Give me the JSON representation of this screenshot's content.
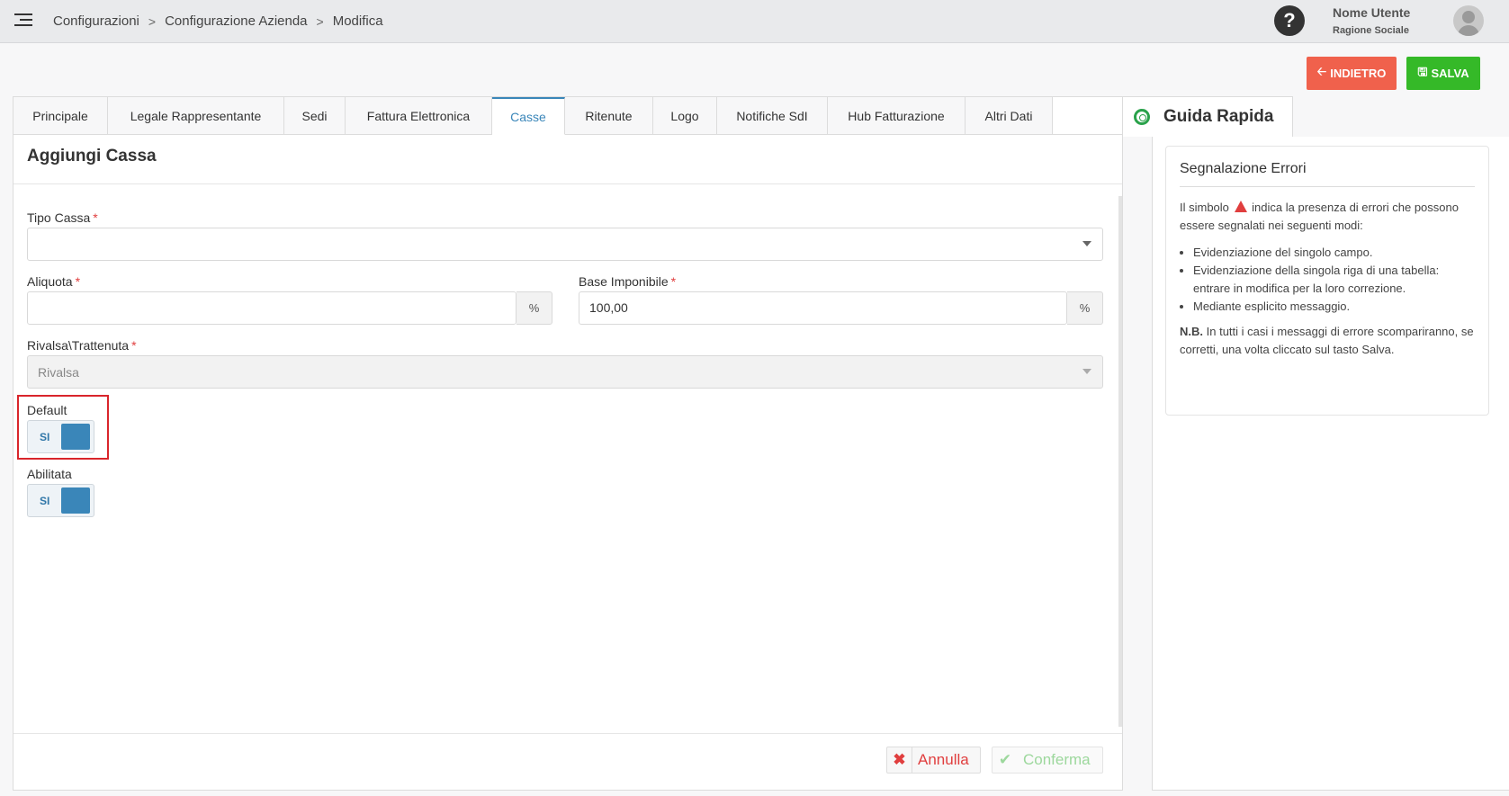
{
  "breadcrumb": [
    "Configurazioni",
    "Configurazione Azienda",
    "Modifica"
  ],
  "user": {
    "name": "Nome Utente",
    "company": "Ragione Sociale"
  },
  "actions": {
    "back": "INDIETRO",
    "save": "SALVA"
  },
  "tabs": [
    {
      "label": "Principale",
      "active": false
    },
    {
      "label": "Legale Rappresentante",
      "active": false
    },
    {
      "label": "Sedi",
      "active": false
    },
    {
      "label": "Fattura Elettronica",
      "active": false
    },
    {
      "label": "Casse",
      "active": true
    },
    {
      "label": "Ritenute",
      "active": false
    },
    {
      "label": "Logo",
      "active": false
    },
    {
      "label": "Notifiche SdI",
      "active": false
    },
    {
      "label": "Hub Fatturazione",
      "active": false
    },
    {
      "label": "Altri Dati",
      "active": false
    }
  ],
  "form": {
    "title": "Aggiungi Cassa",
    "tipo_cassa": {
      "label": "Tipo Cassa",
      "required": "*",
      "value": ""
    },
    "aliquota": {
      "label": "Aliquota",
      "required": "*",
      "value": "",
      "unit": "%"
    },
    "base_imponibile": {
      "label": "Base Imponibile",
      "required": "*",
      "value": "100,00",
      "unit": "%"
    },
    "rivalsa": {
      "label": "Rivalsa\\Trattenuta",
      "required": "*",
      "value": "Rivalsa"
    },
    "default": {
      "label": "Default",
      "value": "SI"
    },
    "abilitata": {
      "label": "Abilitata",
      "value": "SI"
    },
    "cancel": "Annulla",
    "confirm": "Conferma"
  },
  "guide": {
    "title": "Guida Rapida",
    "card_title": "Segnalazione Errori",
    "intro_before": "Il simbolo",
    "intro_after": "indica la presenza di errori che possono essere segnalati nei seguenti modi:",
    "items": [
      "Evidenziazione del singolo campo.",
      "Evidenziazione della singola riga di una tabella: entrare in modifica per la loro correzione.",
      "Mediante esplicito messaggio."
    ],
    "nb_label": "N.B.",
    "nb_text": "In tutti i casi i messaggi di errore scompariranno, se corretti, una volta cliccato sul tasto Salva."
  },
  "colors": {
    "accent": "#3a86b9",
    "back_button": "#f0614c",
    "save_button": "#35b928",
    "error": "#e03e3e"
  }
}
